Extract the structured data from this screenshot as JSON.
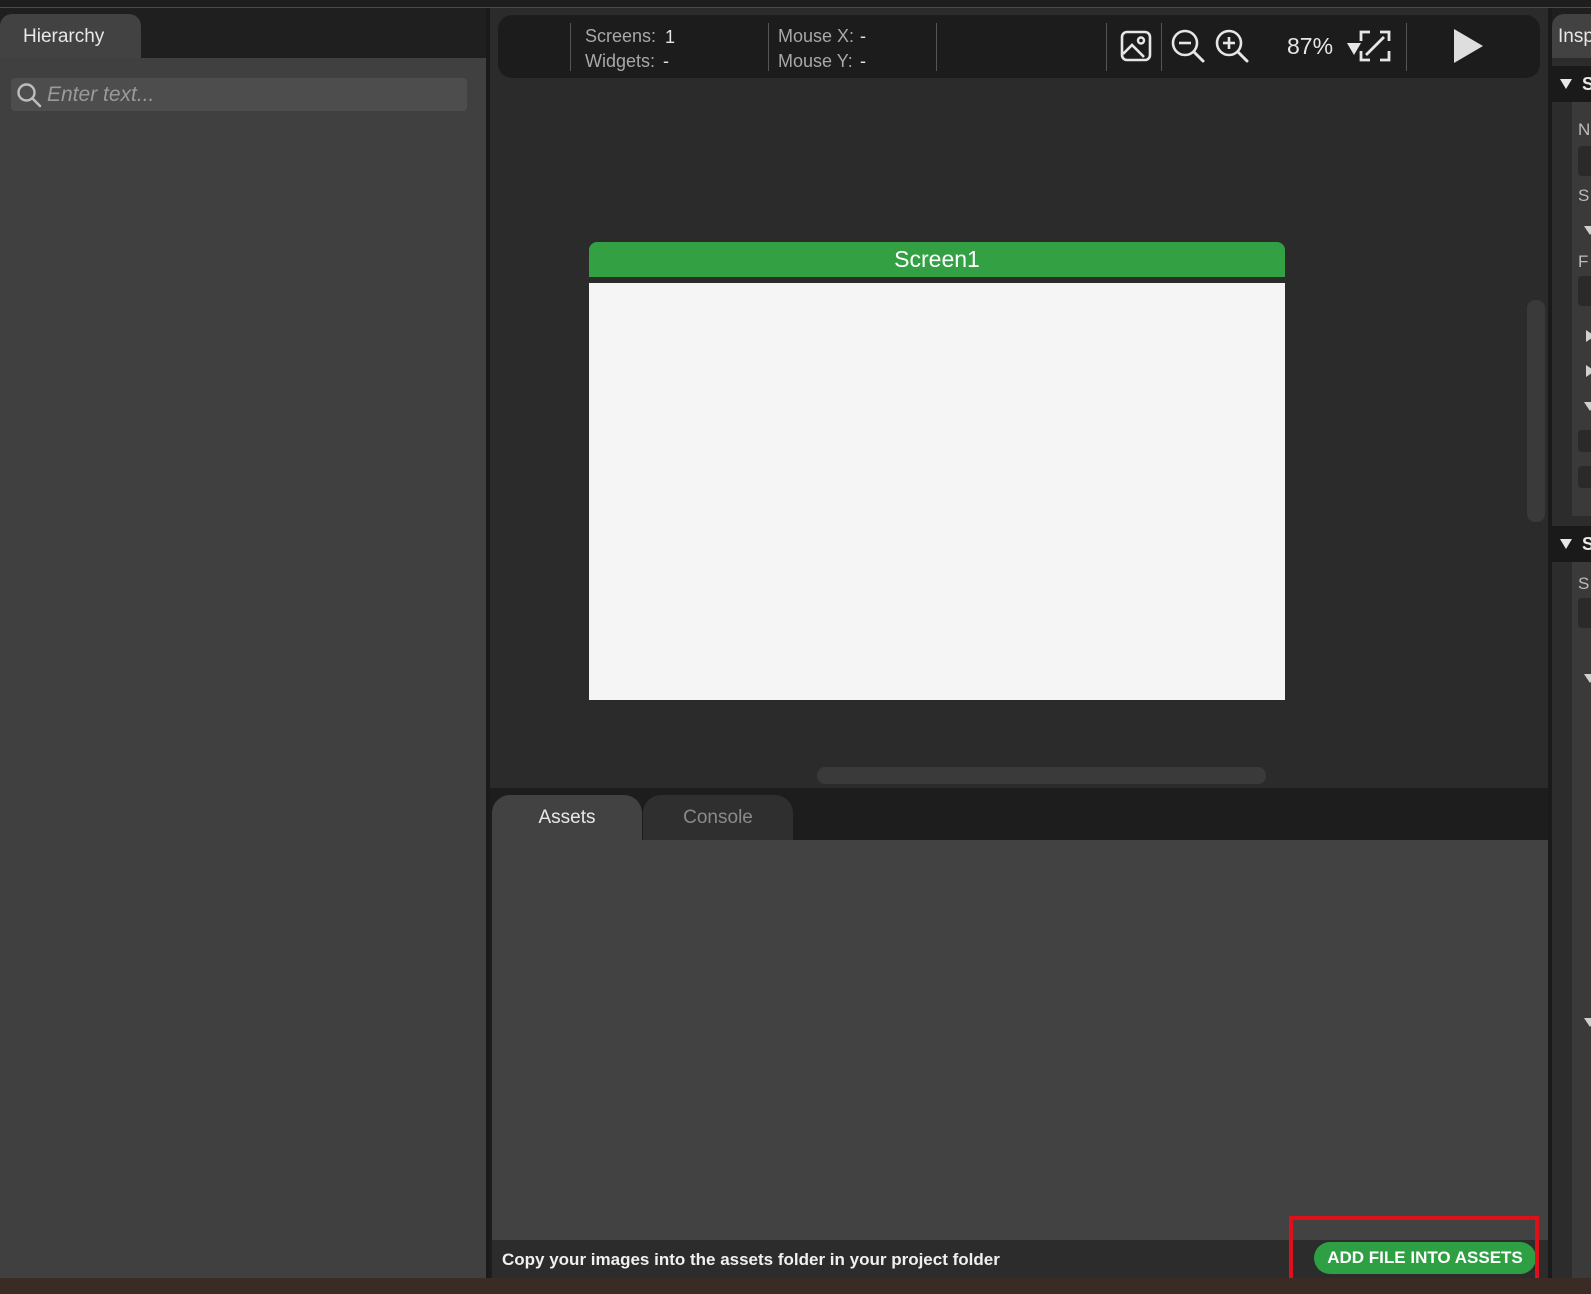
{
  "hierarchy": {
    "tab_label": "Hierarchy",
    "search_placeholder": "Enter text..."
  },
  "toolbar": {
    "screens_label": "Screens:",
    "screens_value": "1",
    "widgets_label": "Widgets:",
    "widgets_value": "-",
    "mouse_x_label": "Mouse X:",
    "mouse_x_value": "-",
    "mouse_y_label": "Mouse Y:",
    "mouse_y_value": "-",
    "zoom": "87%",
    "icons": [
      "image-icon",
      "zoom-out-icon",
      "zoom-in-icon",
      "fit-screen-icon",
      "play-icon"
    ]
  },
  "canvas": {
    "screen_title": "Screen1",
    "screen_header_color": "#33a043"
  },
  "bottom": {
    "tabs": [
      {
        "label": "Assets",
        "active": true
      },
      {
        "label": "Console",
        "active": false
      }
    ],
    "status_text": "Copy your images into the assets folder in your project folder",
    "add_button_label": "ADD FILE INTO ASSETS",
    "add_button_color": "#2ea043",
    "highlight_color": "#e0101a"
  },
  "inspector": {
    "tab_label": "Insp",
    "section1_label": "S",
    "section2_label": "S",
    "label_n": "N",
    "label_s": "S",
    "label_f": "F",
    "label_s2": "S"
  }
}
